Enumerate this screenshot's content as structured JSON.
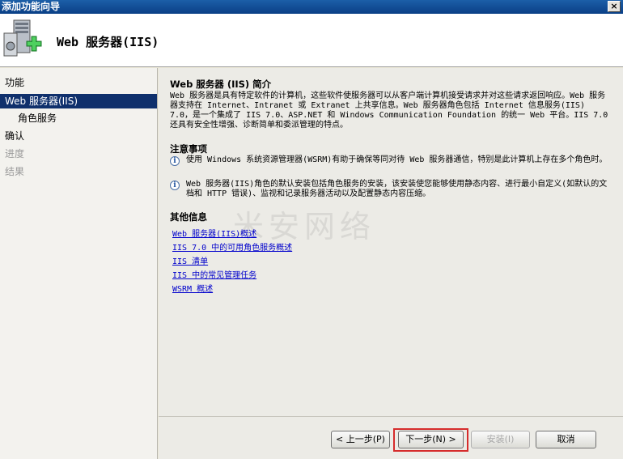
{
  "window": {
    "title": "添加功能向导",
    "close_label": "×"
  },
  "header": {
    "title": "Web 服务器(IIS)",
    "icon": "server-add-icon"
  },
  "sidebar": {
    "items": [
      {
        "label": "功能",
        "state": "normal"
      },
      {
        "label": "Web 服务器(IIS)",
        "state": "selected"
      },
      {
        "label": "角色服务",
        "state": "normal"
      },
      {
        "label": "确认",
        "state": "normal"
      },
      {
        "label": "进度",
        "state": "disabled"
      },
      {
        "label": "结果",
        "state": "disabled"
      }
    ]
  },
  "content": {
    "intro_title": "Web 服务器 (IIS) 简介",
    "intro_text": "Web 服务器是具有特定软件的计算机，这些软件使服务器可以从客户端计算机接受请求并对这些请求返回响应。Web 服务器支持在 Internet、Intranet 或 Extranet 上共享信息。Web 服务器角色包括 Internet 信息服务(IIS) 7.0，是一个集成了 IIS 7.0、ASP.NET 和 Windows Communication Foundation 的统一 Web 平台。IIS 7.0 还具有安全性增强、诊断简单和委派管理的特点。",
    "notes_title": "注意事项",
    "notes": [
      "使用 Windows 系统资源管理器(WSRM)有助于确保等同对待 Web 服务器通信，特别是此计算机上存在多个角色时。",
      "Web 服务器(IIS)角色的默认安装包括角色服务的安装，该安装使您能够使用静态内容、进行最小自定义(如默认的文档和 HTTP 错误)、监视和记录服务器活动以及配置静态内容压缩。"
    ],
    "more_title": "其他信息",
    "links": [
      "Web 服务器(IIS)概述",
      "IIS 7.0 中的可用角色服务概述",
      "IIS 清单",
      "IIS 中的常见管理任务",
      "WSRM 概述"
    ],
    "watermark": "米安网络"
  },
  "footer": {
    "back_label": "< 上一步(P)",
    "next_label": "下一步(N) >",
    "install_label": "安装(I)",
    "cancel_label": "取消"
  },
  "colors": {
    "selected_bg": "#0f306c",
    "focus_ring": "#d62c2c",
    "link": "#0000cc"
  }
}
